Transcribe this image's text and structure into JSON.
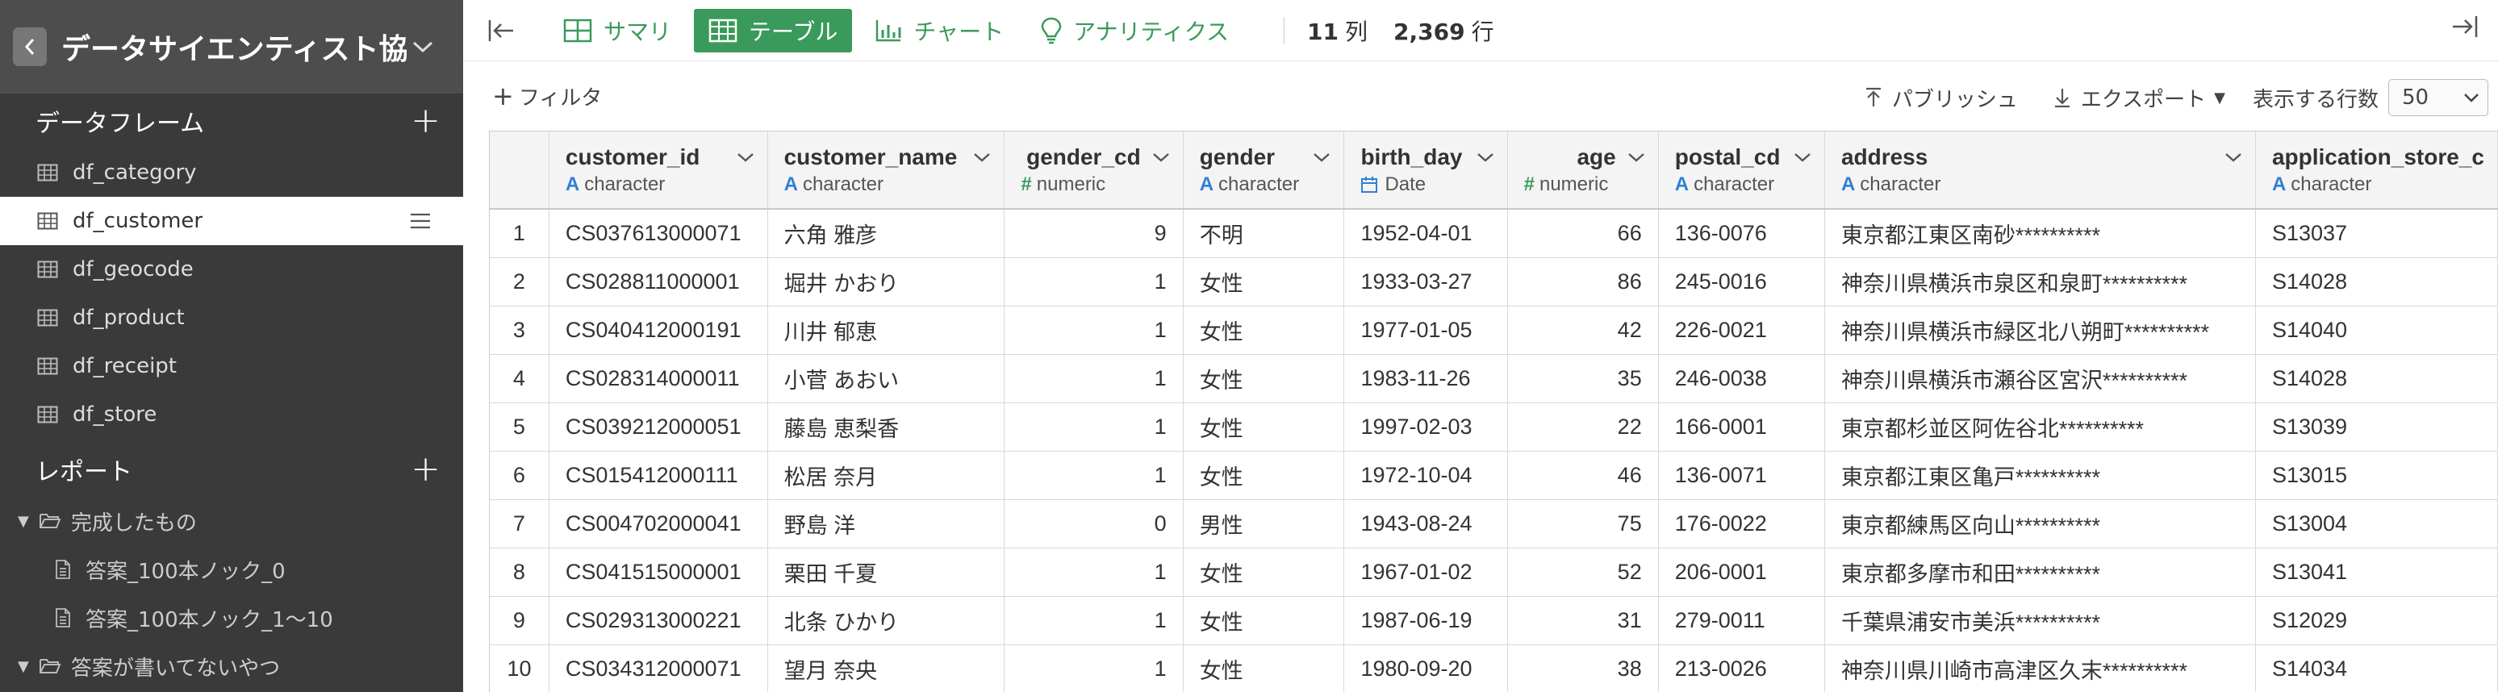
{
  "project": {
    "title": "データサイエンティスト協..."
  },
  "sidebar": {
    "dataframes_title": "データフレーム",
    "dataframes": [
      {
        "label": "df_category",
        "active": false
      },
      {
        "label": "df_customer",
        "active": true
      },
      {
        "label": "df_geocode",
        "active": false
      },
      {
        "label": "df_product",
        "active": false
      },
      {
        "label": "df_receipt",
        "active": false
      },
      {
        "label": "df_store",
        "active": false
      }
    ],
    "reports_title": "レポート",
    "folder1": "完成したもの",
    "reports": [
      "答案_100本ノック_0",
      "答案_100本ノック_1〜10"
    ],
    "folder2": "答案が書いてないやつ"
  },
  "toolbar": {
    "tabs": [
      {
        "label": "サマリ",
        "icon": "summary-icon"
      },
      {
        "label": "テーブル",
        "icon": "table-icon",
        "active": true
      },
      {
        "label": "チャート",
        "icon": "chart-icon"
      },
      {
        "label": "アナリティクス",
        "icon": "bulb-icon"
      }
    ],
    "columns_count": "11",
    "columns_unit": "列",
    "rows_count": "2,369",
    "rows_unit": "行"
  },
  "subbar": {
    "filter": "フィルタ",
    "publish": "パブリッシュ",
    "export": "エクスポート",
    "rows_label": "表示する行数",
    "rows_value": "50"
  },
  "table": {
    "columns": [
      {
        "name": "customer_id",
        "type": "character",
        "icon": "A",
        "align": "left"
      },
      {
        "name": "customer_name",
        "type": "character",
        "icon": "A",
        "align": "left"
      },
      {
        "name": "gender_cd",
        "type": "numeric",
        "icon": "#",
        "align": "right"
      },
      {
        "name": "gender",
        "type": "character",
        "icon": "A",
        "align": "left"
      },
      {
        "name": "birth_day",
        "type": "Date",
        "icon": "date",
        "align": "left"
      },
      {
        "name": "age",
        "type": "numeric",
        "icon": "#",
        "align": "right"
      },
      {
        "name": "postal_cd",
        "type": "character",
        "icon": "A",
        "align": "left"
      },
      {
        "name": "address",
        "type": "character",
        "icon": "A",
        "align": "left"
      },
      {
        "name": "application_store_c",
        "type": "character",
        "icon": "A",
        "align": "left"
      }
    ],
    "rows": [
      [
        "1",
        "CS037613000071",
        "六角 雅彦",
        "9",
        "不明",
        "1952-04-01",
        "66",
        "136-0076",
        "東京都江東区南砂**********",
        "S13037"
      ],
      [
        "2",
        "CS028811000001",
        "堀井 かおり",
        "1",
        "女性",
        "1933-03-27",
        "86",
        "245-0016",
        "神奈川県横浜市泉区和泉町**********",
        "S14028"
      ],
      [
        "3",
        "CS040412000191",
        "川井 郁恵",
        "1",
        "女性",
        "1977-01-05",
        "42",
        "226-0021",
        "神奈川県横浜市緑区北八朔町**********",
        "S14040"
      ],
      [
        "4",
        "CS028314000011",
        "小菅 あおい",
        "1",
        "女性",
        "1983-11-26",
        "35",
        "246-0038",
        "神奈川県横浜市瀬谷区宮沢**********",
        "S14028"
      ],
      [
        "5",
        "CS039212000051",
        "藤島 恵梨香",
        "1",
        "女性",
        "1997-02-03",
        "22",
        "166-0001",
        "東京都杉並区阿佐谷北**********",
        "S13039"
      ],
      [
        "6",
        "CS015412000111",
        "松居 奈月",
        "1",
        "女性",
        "1972-10-04",
        "46",
        "136-0071",
        "東京都江東区亀戸**********",
        "S13015"
      ],
      [
        "7",
        "CS004702000041",
        "野島 洋",
        "0",
        "男性",
        "1943-08-24",
        "75",
        "176-0022",
        "東京都練馬区向山**********",
        "S13004"
      ],
      [
        "8",
        "CS041515000001",
        "栗田 千夏",
        "1",
        "女性",
        "1967-01-02",
        "52",
        "206-0001",
        "東京都多摩市和田**********",
        "S13041"
      ],
      [
        "9",
        "CS029313000221",
        "北条 ひかり",
        "1",
        "女性",
        "1987-06-19",
        "31",
        "279-0011",
        "千葉県浦安市美浜**********",
        "S12029"
      ],
      [
        "10",
        "CS034312000071",
        "望月 奈央",
        "1",
        "女性",
        "1980-09-20",
        "38",
        "213-0026",
        "神奈川県川崎市高津区久末**********",
        "S14034"
      ]
    ]
  },
  "colors": {
    "accent": "#3a9a5b",
    "sidebar": "#3a3a3a",
    "type_char": "#2f7fd6"
  }
}
